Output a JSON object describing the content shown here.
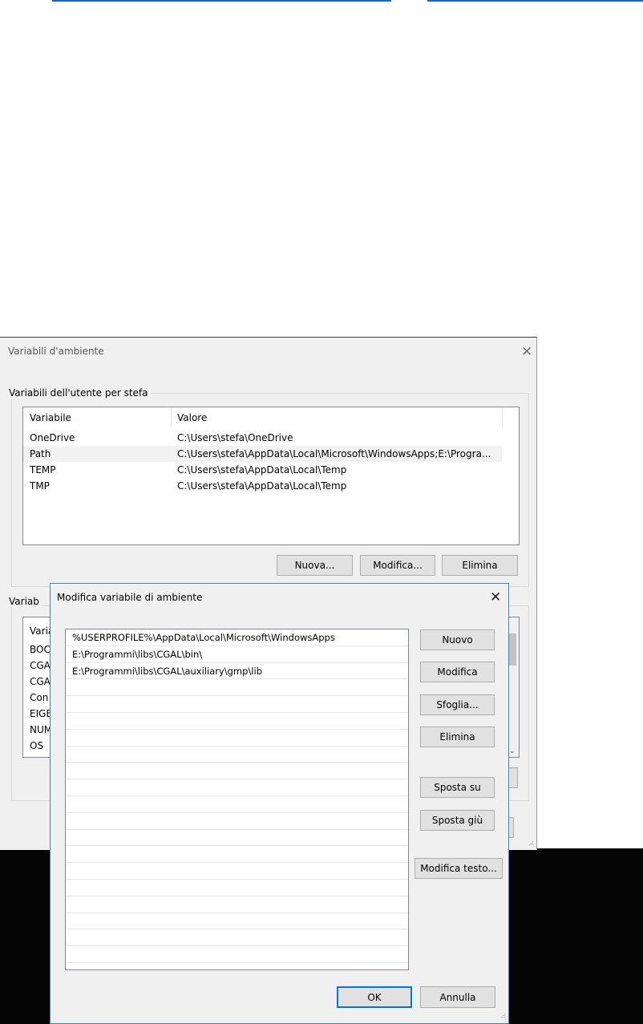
{
  "background_dialog": {
    "title": "Variabili d'ambiente",
    "user_vars": {
      "group_label": "Variabili dell'utente per stefa",
      "columns": [
        "Variabile",
        "Valore"
      ],
      "rows": [
        {
          "name": "OneDrive",
          "value": "C:\\Users\\stefa\\OneDrive"
        },
        {
          "name": "Path",
          "value": "C:\\Users\\stefa\\AppData\\Local\\Microsoft\\WindowsApps;E:\\Progra..."
        },
        {
          "name": "TEMP",
          "value": "C:\\Users\\stefa\\AppData\\Local\\Temp"
        },
        {
          "name": "TMP",
          "value": "C:\\Users\\stefa\\AppData\\Local\\Temp"
        }
      ],
      "buttons": {
        "new": "Nuova...",
        "edit": "Modifica...",
        "delete": "Elimina"
      }
    },
    "system_vars": {
      "group_label": "Variab",
      "column": "Varia",
      "rows": [
        "BOC",
        "CGA",
        "CGA",
        "Con",
        "EIGE",
        "NUM",
        "OS"
      ]
    }
  },
  "edit_dialog": {
    "title": "Modifica variabile di ambiente",
    "entries": [
      "%USERPROFILE%\\AppData\\Local\\Microsoft\\WindowsApps",
      "E:\\Programmi\\libs\\CGAL\\bin\\",
      "E:\\Programmi\\libs\\CGAL\\auxiliary\\gmp\\lib"
    ],
    "buttons": {
      "new": "Nuovo",
      "edit": "Modifica",
      "browse": "Sfoglia...",
      "delete": "Elimina",
      "move_up": "Sposta su",
      "move_down": "Sposta giù",
      "edit_text": "Modifica testo...",
      "ok": "OK",
      "cancel": "Annulla"
    }
  },
  "colors": {
    "accent": "#0078d7",
    "selected_row": "#f2f2f2",
    "dialog_bg": "#f0f0f0"
  }
}
